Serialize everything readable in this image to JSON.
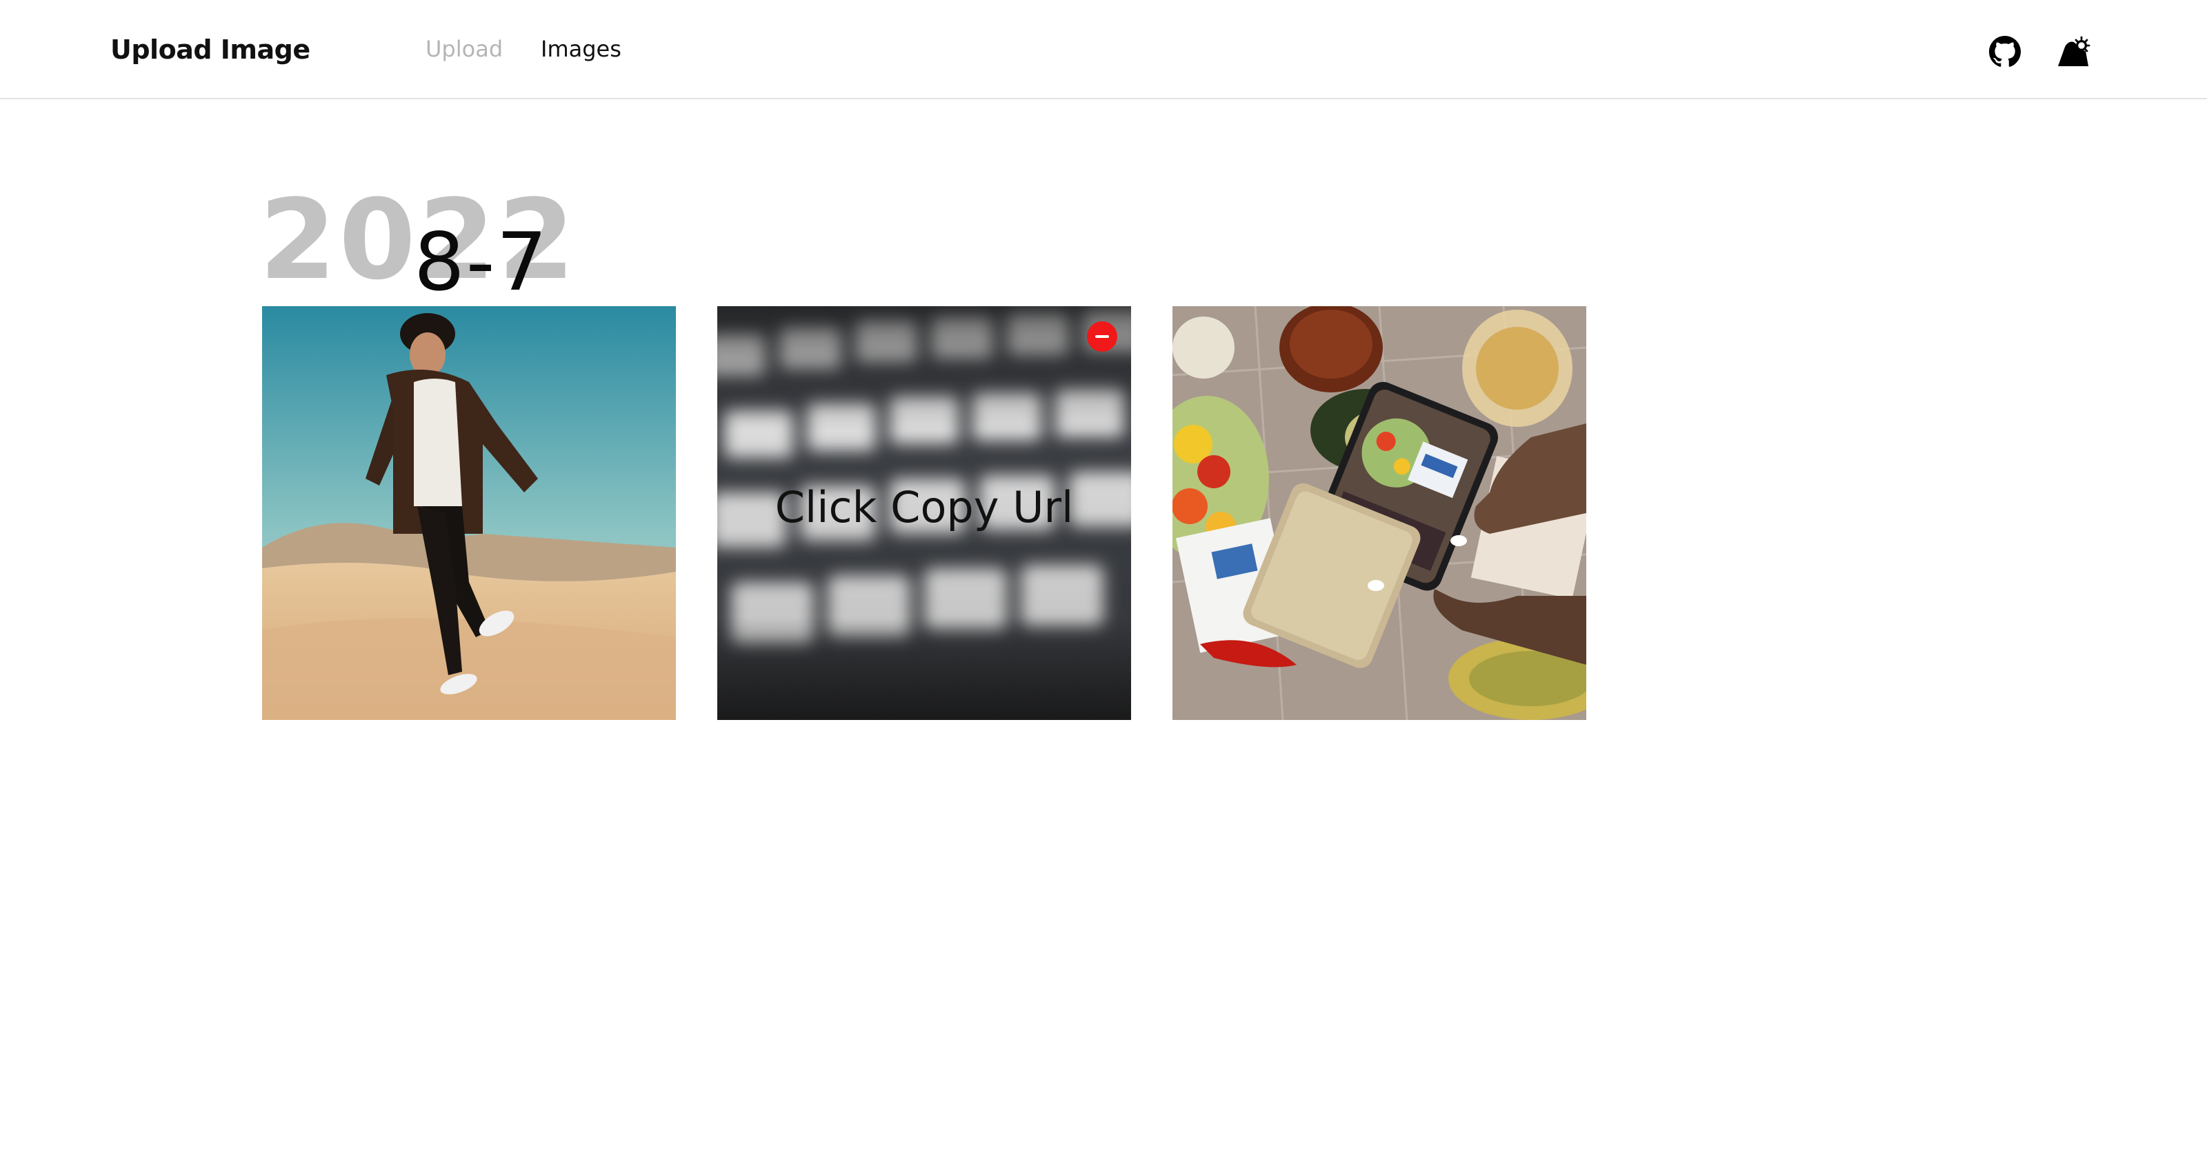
{
  "header": {
    "brand": "Upload Image",
    "nav": {
      "upload": "Upload",
      "images": "Images"
    },
    "icons": [
      "github-icon",
      "theme-toggle-icon"
    ]
  },
  "gallery": {
    "year": "2022",
    "date": "8-7",
    "hover_text": "Click Copy Url",
    "colors": {
      "delete": "#f01818",
      "year": "#c2c2c2",
      "inactive_nav": "#b5b5b5"
    },
    "images": [
      {
        "subject": "man-walking-on-sand-dunes-photo"
      },
      {
        "subject": "blurred-keyboard-photo"
      },
      {
        "subject": "phone-photographing-food-photo"
      }
    ]
  }
}
